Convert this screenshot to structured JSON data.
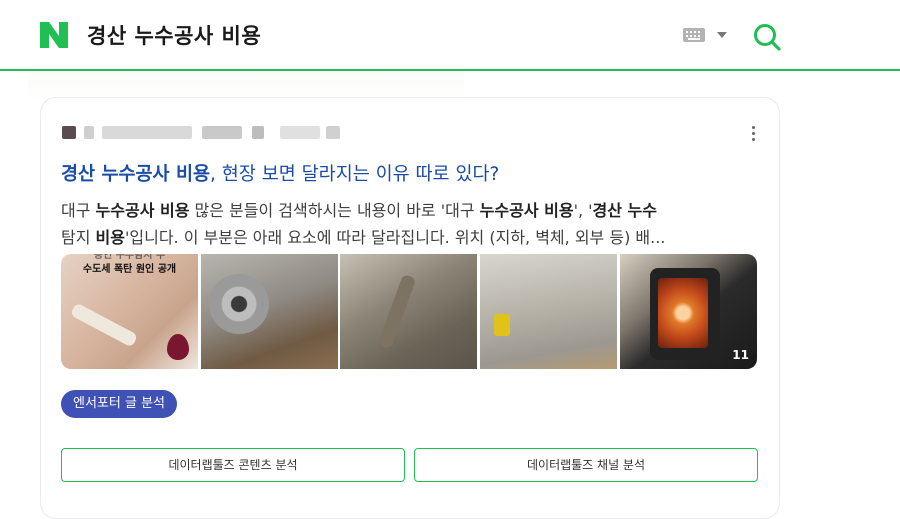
{
  "header": {
    "query": "경산 누수공사 비용",
    "brand_color": "#1fbf54",
    "logo_icon": "naver-n-logo",
    "keyboard_icon": "keyboard-icon",
    "search_icon": "search-icon"
  },
  "result": {
    "title_highlight": "경산 누수공사 비용",
    "title_rest": ", 현장 보면 달라지는 이유 따로 있다?",
    "snippet_line1": [
      {
        "t": "대구 ",
        "b": false
      },
      {
        "t": "누수공사 비용",
        "b": true
      },
      {
        "t": " 많은 분들이 검색하시는 내용이 바로 '대구 ",
        "b": false
      },
      {
        "t": "누수공사 비용",
        "b": true
      },
      {
        "t": "', '",
        "b": false
      },
      {
        "t": "경산 누수",
        "b": true
      }
    ],
    "snippet_line2": [
      {
        "t": "탐지 ",
        "b": false
      },
      {
        "t": "비용",
        "b": true
      },
      {
        "t": "'입니다. 이 부분은 아래 요소에 따라 달라집니다. 위치 (지하, 벽체, 외부 등) 배...",
        "b": false
      }
    ],
    "thumb1_caption_line1": "공인 누수탐지 수",
    "thumb1_caption_line2": "수도세 폭탄 원인 공개",
    "image_count": "11",
    "badge": "엔서포터 글 분석",
    "btn_content": "데이터랩툴즈 콘텐츠 분석",
    "btn_channel": "데이터랩툴즈 채널 분석"
  }
}
